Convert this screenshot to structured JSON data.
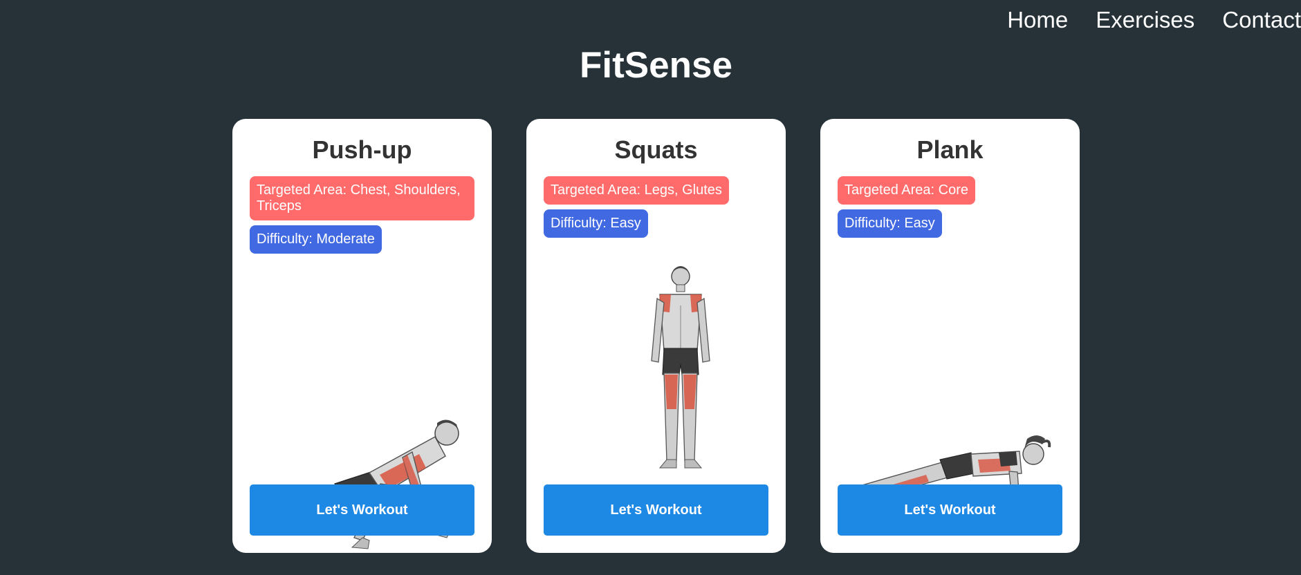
{
  "nav": {
    "items": [
      "Home",
      "Exercises",
      "Contact"
    ]
  },
  "page_title": "FitSense",
  "colors": {
    "background": "#263238",
    "card": "#ffffff",
    "area_tag": "#ff6b6b",
    "difficulty_tag": "#4169e1",
    "button": "#1e88e5"
  },
  "cards": [
    {
      "title": "Push-up",
      "area": "Targeted Area: Chest, Shoulders, Triceps",
      "difficulty": "Difficulty: Moderate",
      "illustration": "push-up-figure",
      "button": "Let's Workout"
    },
    {
      "title": "Squats",
      "area": "Targeted Area: Legs, Glutes",
      "difficulty": "Difficulty: Easy",
      "illustration": "standing-figure",
      "button": "Let's Workout"
    },
    {
      "title": "Plank",
      "area": "Targeted Area: Core",
      "difficulty": "Difficulty: Easy",
      "illustration": "plank-figure",
      "button": "Let's Workout"
    }
  ]
}
